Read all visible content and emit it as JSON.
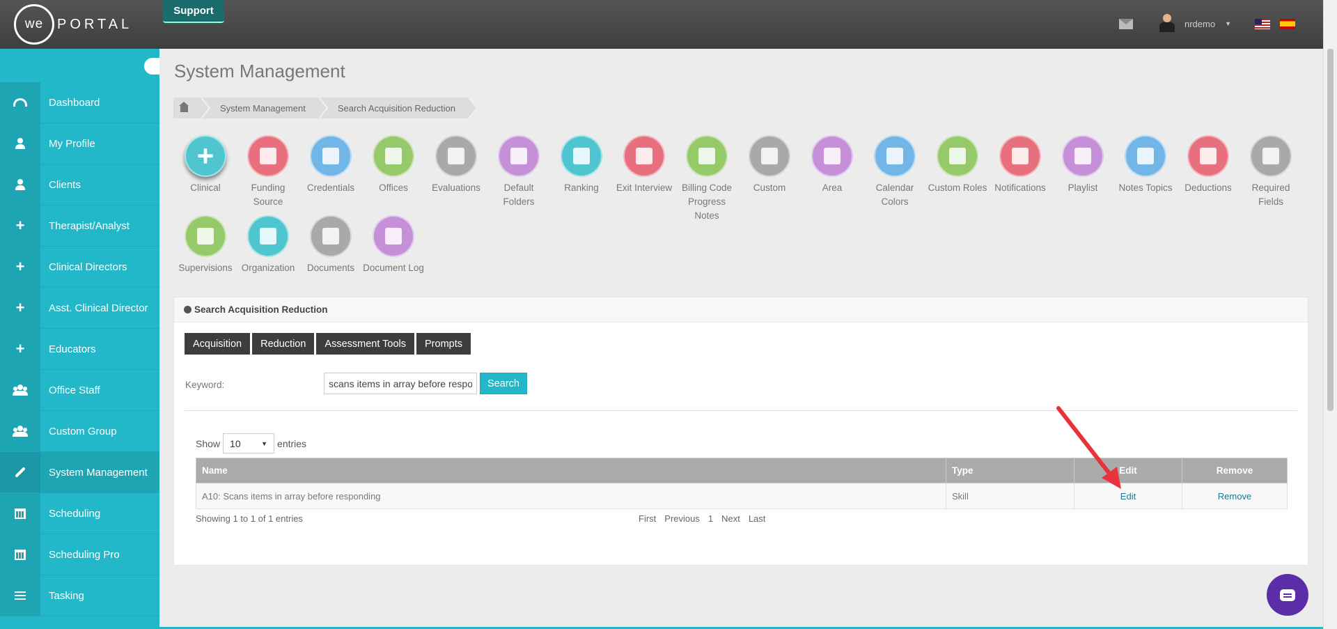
{
  "header": {
    "logo_we": "we",
    "logo_portal": "PORTAL",
    "support_label": "Support",
    "username": "nrdemo"
  },
  "sidebar": {
    "items": [
      {
        "label": "Dashboard",
        "icon": "dashboard-icon"
      },
      {
        "label": "My Profile",
        "icon": "user-icon"
      },
      {
        "label": "Clients",
        "icon": "user-icon"
      },
      {
        "label": "Therapist/Analyst",
        "icon": "plus-icon"
      },
      {
        "label": "Clinical Directors",
        "icon": "plus-icon"
      },
      {
        "label": "Asst. Clinical Director",
        "icon": "plus-icon"
      },
      {
        "label": "Educators",
        "icon": "plus-icon"
      },
      {
        "label": "Office Staff",
        "icon": "users-icon"
      },
      {
        "label": "Custom Group",
        "icon": "users-icon"
      },
      {
        "label": "System Management",
        "icon": "wrench-icon"
      },
      {
        "label": "Scheduling",
        "icon": "calendar-icon"
      },
      {
        "label": "Scheduling Pro",
        "icon": "calendar-icon"
      },
      {
        "label": "Tasking",
        "icon": "tasks-icon"
      }
    ]
  },
  "main": {
    "title": "System Management",
    "breadcrumb": [
      "System Management",
      "Search Acquisition Reduction"
    ]
  },
  "modules": [
    {
      "label": "Clinical",
      "color": "#4fc6cf"
    },
    {
      "label": "Funding Source",
      "color": "#e8707e"
    },
    {
      "label": "Credentials",
      "color": "#72b6e8"
    },
    {
      "label": "Offices",
      "color": "#96c96a"
    },
    {
      "label": "Evaluations",
      "color": "#a9a9a9"
    },
    {
      "label": "Default Folders",
      "color": "#c590d8"
    },
    {
      "label": "Ranking",
      "color": "#4fc6cf"
    },
    {
      "label": "Exit Interview",
      "color": "#e8707e"
    },
    {
      "label": "Billing Code Progress Notes",
      "color": "#96c96a"
    },
    {
      "label": "Custom",
      "color": "#a9a9a9"
    },
    {
      "label": "Area",
      "color": "#c590d8"
    },
    {
      "label": "Calendar Colors",
      "color": "#72b6e8"
    },
    {
      "label": "Custom Roles",
      "color": "#96c96a"
    },
    {
      "label": "Notifications",
      "color": "#e8707e"
    },
    {
      "label": "Playlist",
      "color": "#c590d8"
    },
    {
      "label": "Notes Topics",
      "color": "#72b6e8"
    },
    {
      "label": "Deductions",
      "color": "#e8707e"
    },
    {
      "label": "Required Fields",
      "color": "#a9a9a9"
    },
    {
      "label": "Supervisions",
      "color": "#96c96a"
    },
    {
      "label": "Organization",
      "color": "#4fc6cf"
    },
    {
      "label": "Documents",
      "color": "#a9a9a9"
    },
    {
      "label": "Document Log",
      "color": "#c590d8"
    }
  ],
  "panel": {
    "title": "Search Acquisition Reduction",
    "tabs": [
      "Acquisition",
      "Reduction",
      "Assessment Tools",
      "Prompts"
    ],
    "keyword_label": "Keyword:",
    "keyword_value": "scans items in array before respo",
    "search_label": "Search",
    "show_label": "Show",
    "entries_label": "entries",
    "page_size": "10",
    "table": {
      "headers": [
        "Name",
        "Type",
        "Edit",
        "Remove"
      ],
      "rows": [
        {
          "name": "A10: Scans items in array before responding",
          "type": "Skill",
          "edit": "Edit",
          "remove": "Remove"
        }
      ]
    },
    "info": "Showing 1 to 1 of 1 entries",
    "pager": [
      "First",
      "Previous",
      "1",
      "Next",
      "Last"
    ]
  },
  "colors": {
    "accent": "#22b8c9",
    "arrow": "#e8333c",
    "chat": "#5b2ea8"
  }
}
